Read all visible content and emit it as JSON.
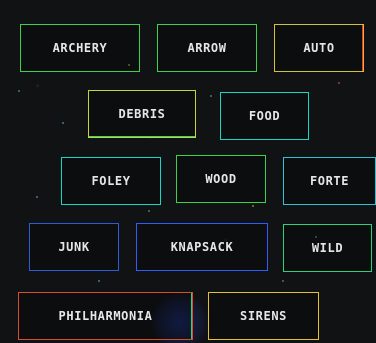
{
  "theme": {
    "background": "#111214",
    "text": "#e6e6e6",
    "accents": {
      "green": "#3cd14a",
      "teal": "#18d6c7",
      "cyan": "#2cc3d8",
      "blue": "#2d5cff",
      "yellow": "#e5c12f",
      "orange": "#ff7a2e",
      "red": "#ff2d2d"
    }
  },
  "tags": [
    {
      "id": "archery",
      "label": "ARCHERY"
    },
    {
      "id": "arrow",
      "label": "ARROW"
    },
    {
      "id": "auto",
      "label": "AUTO"
    },
    {
      "id": "debris",
      "label": "DEBRIS"
    },
    {
      "id": "food",
      "label": "FOOD"
    },
    {
      "id": "foley",
      "label": "FOLEY"
    },
    {
      "id": "wood",
      "label": "WOOD"
    },
    {
      "id": "forte",
      "label": "FORTE"
    },
    {
      "id": "junk",
      "label": "JUNK"
    },
    {
      "id": "knapsack",
      "label": "KNAPSACK"
    },
    {
      "id": "wild",
      "label": "WILD"
    },
    {
      "id": "philharmonia",
      "label": "PHILHARMONIA"
    },
    {
      "id": "sirens",
      "label": "SIRENS"
    }
  ]
}
